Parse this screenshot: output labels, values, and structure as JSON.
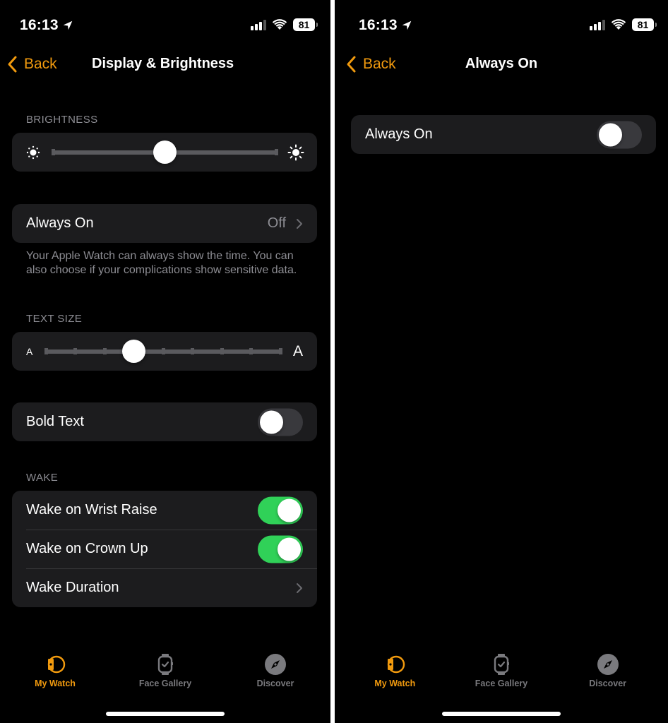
{
  "accent_color": "#f19a0e",
  "toggle_on_color": "#30d158",
  "screens": [
    {
      "status_bar": {
        "time": "16:13",
        "battery": "81",
        "location_icon": "location-arrow-icon",
        "signal_icon": "cellular-signal-icon",
        "wifi_icon": "wifi-icon"
      },
      "nav": {
        "back_label": "Back",
        "title": "Display & Brightness"
      },
      "brightness": {
        "header": "BRIGHTNESS",
        "value": 0.5,
        "min_icon": "sun-small-icon",
        "max_icon": "sun-large-icon"
      },
      "always_on": {
        "label": "Always On",
        "value": "Off",
        "footer": "Your Apple Watch can always show the time. You can also choose if your complications show sensitive data."
      },
      "text_size": {
        "header": "TEXT SIZE",
        "steps": 9,
        "value_index": 3,
        "min_label": "A",
        "max_label": "A"
      },
      "bold_text": {
        "label": "Bold Text",
        "on": false
      },
      "wake": {
        "header": "WAKE",
        "items": [
          {
            "label": "Wake on Wrist Raise",
            "type": "toggle",
            "on": true
          },
          {
            "label": "Wake on Crown Up",
            "type": "toggle",
            "on": true
          },
          {
            "label": "Wake Duration",
            "type": "link"
          }
        ]
      },
      "tabbar": {
        "tabs": [
          {
            "label": "My Watch",
            "icon": "my-watch-icon",
            "active": true
          },
          {
            "label": "Face Gallery",
            "icon": "face-gallery-icon",
            "active": false
          },
          {
            "label": "Discover",
            "icon": "compass-icon",
            "active": false
          }
        ]
      }
    },
    {
      "status_bar": {
        "time": "16:13",
        "battery": "81",
        "location_icon": "location-arrow-icon",
        "signal_icon": "cellular-signal-icon",
        "wifi_icon": "wifi-icon"
      },
      "nav": {
        "back_label": "Back",
        "title": "Always On"
      },
      "always_on_toggle": {
        "label": "Always On",
        "on": false
      },
      "tabbar": {
        "tabs": [
          {
            "label": "My Watch",
            "icon": "my-watch-icon",
            "active": true
          },
          {
            "label": "Face Gallery",
            "icon": "face-gallery-icon",
            "active": false
          },
          {
            "label": "Discover",
            "icon": "compass-icon",
            "active": false
          }
        ]
      }
    }
  ]
}
